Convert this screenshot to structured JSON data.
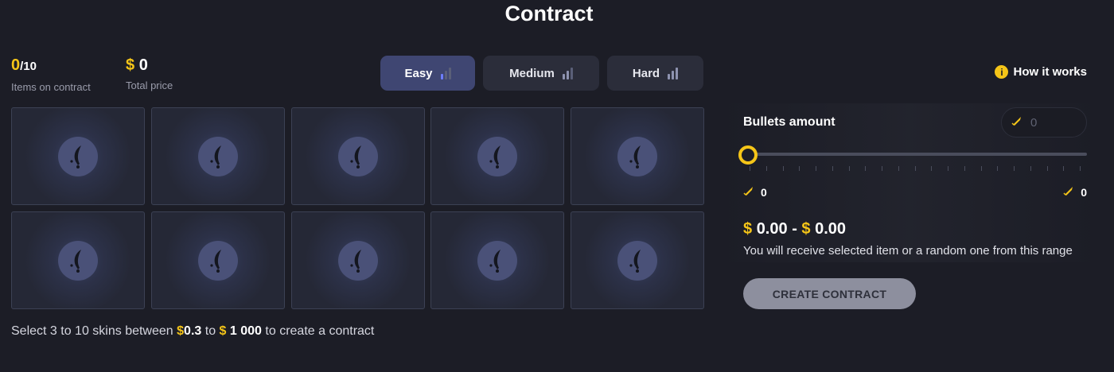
{
  "page": {
    "title": "Contract"
  },
  "stats": {
    "items_count": "0",
    "items_max": "/10",
    "items_caption": "Items on contract",
    "currency": "$",
    "total_price": "0",
    "total_caption": "Total price"
  },
  "difficulty": {
    "options": [
      {
        "label": "Easy",
        "active": true
      },
      {
        "label": "Medium",
        "active": false
      },
      {
        "label": "Hard",
        "active": false
      }
    ]
  },
  "how_it_works": {
    "icon": "info-icon",
    "label": "How it works"
  },
  "slots": {
    "count": 10,
    "icon": "knife-icon"
  },
  "hint": {
    "prefix": "Select 3 to 10 skins between",
    "currency": "$",
    "min": "0.3",
    "to": "to",
    "max": "1 000",
    "suffix": "to create a contract"
  },
  "bullets": {
    "label": "Bullets amount",
    "input_placeholder": "0",
    "slider_value": 0,
    "min_value": "0",
    "max_value": "0",
    "icon": "bullet-icon"
  },
  "price_range": {
    "currency": "$",
    "from": "0.00",
    "separator": "-",
    "to": "0.00",
    "note": "You will receive selected item or a random one from this range"
  },
  "create_button": {
    "label": "CREATE CONTRACT"
  },
  "colors": {
    "accent": "#f5c518",
    "active_tab": "#3f4672",
    "background": "#1c1d26"
  }
}
